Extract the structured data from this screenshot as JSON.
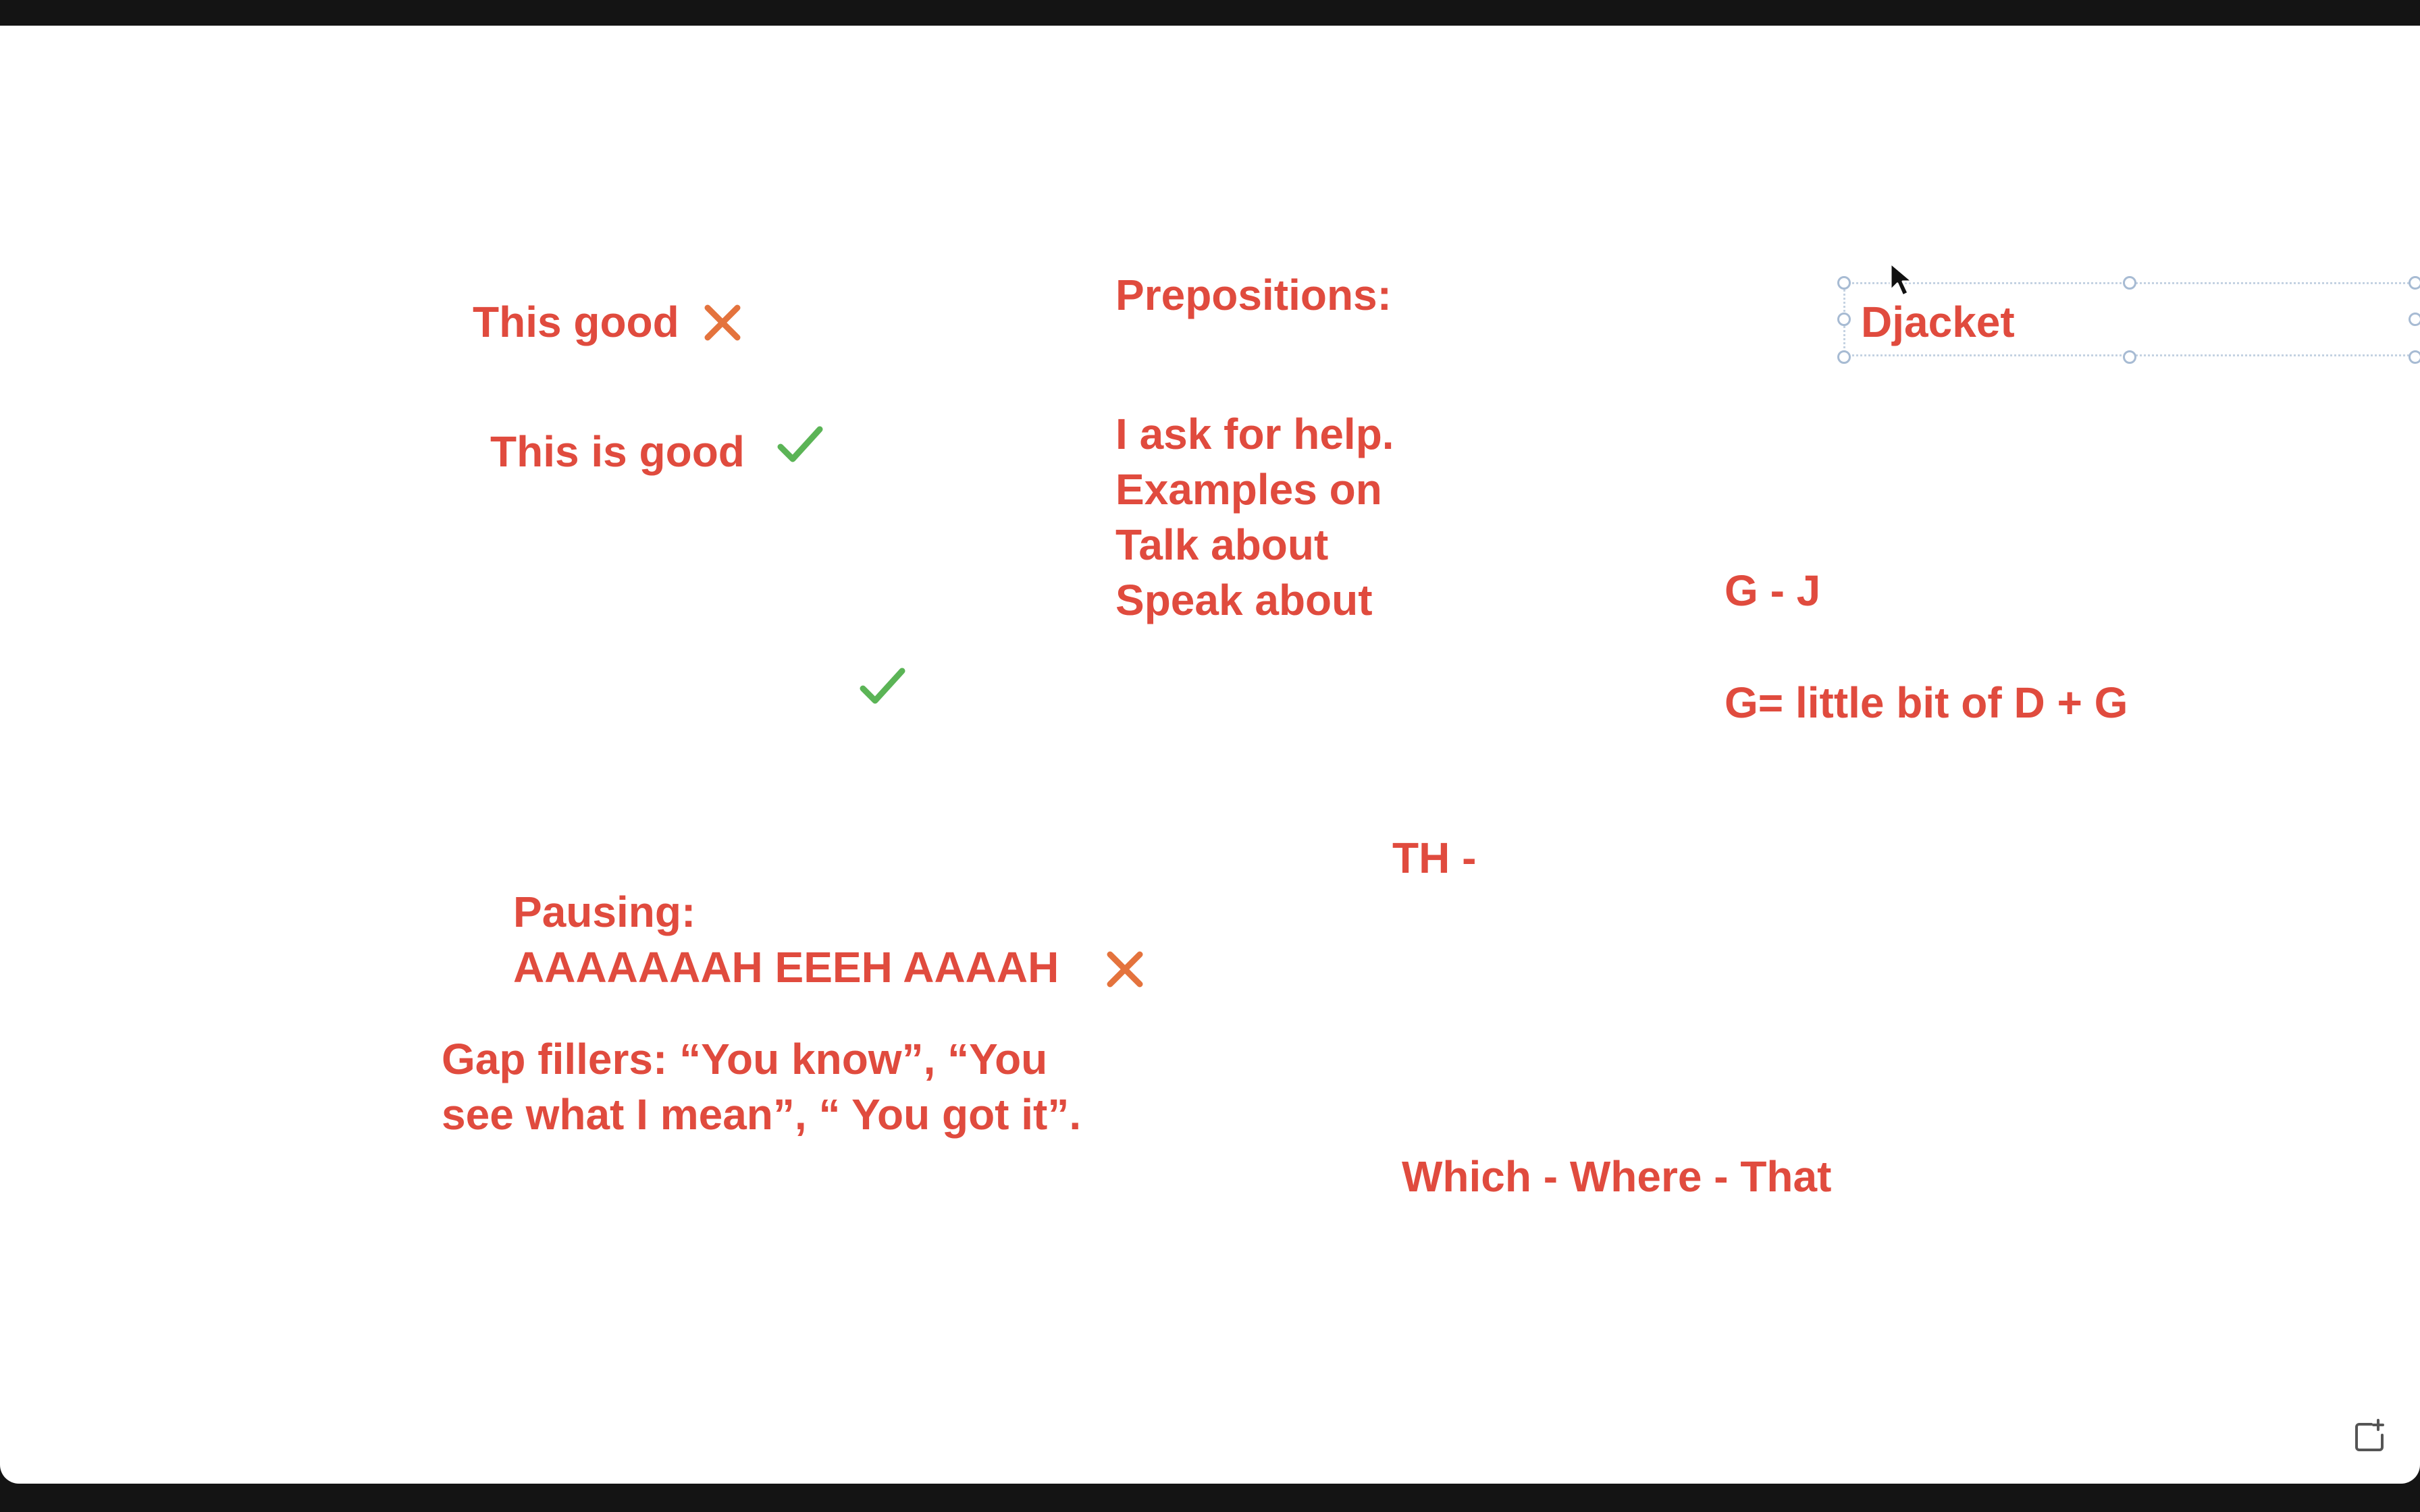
{
  "colors": {
    "text": "#e04b3e",
    "cross": "#e4733d",
    "check": "#5bb456",
    "frame": "#141414",
    "canvas": "#ffffff",
    "selection": "#a7bbd3"
  },
  "icons": {
    "cross": "x-mark-icon",
    "check": "check-mark-icon",
    "cursor": "mouse-cursor-icon",
    "corner": "expand-corner-icon"
  },
  "notes": {
    "this_good": "This good",
    "this_is_good": "This is good",
    "prepositions_heading": "Prepositions:",
    "prepositions_lines": [
      "I ask for help.",
      "Examples on",
      "Talk about",
      "Speak about"
    ],
    "djacket": "Djacket",
    "g_j": "G - J",
    "g_rule": "G= little bit of D + G",
    "th": "TH -",
    "pausing_heading": "Pausing:",
    "pausing_line": "AAAAAAAH EEEH AAAAH",
    "gap_fillers_lines": [
      "Gap fillers: “You know”, “You",
      "see what I mean”, “ You got it”."
    ],
    "which_where_that": "Which - Where - That"
  }
}
